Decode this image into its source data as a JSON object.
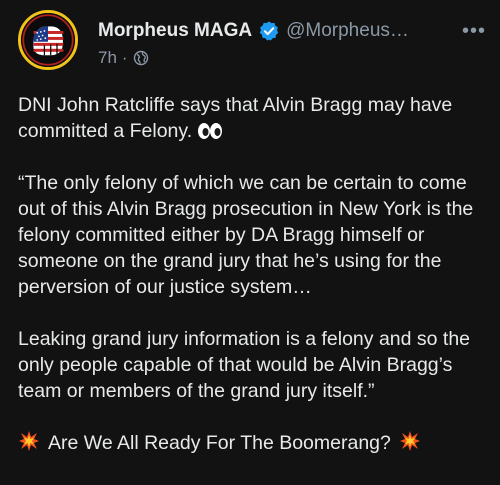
{
  "author": {
    "display_name": "Morpheus MAGA",
    "handle": "@Morpheus…",
    "verified": true,
    "avatar_icon": "american-flag-fist-avatar"
  },
  "meta": {
    "time": "7h",
    "separator": "·",
    "audience_icon": "globe-icon"
  },
  "menu": {
    "more_label": "•••"
  },
  "post": {
    "line1": "DNI John Ratcliffe says that Alvin Bragg may have committed a Felony.",
    "line1_emoji": "eyes-emoji",
    "quote": "“The only felony of which we can be certain to come out of this Alvin Bragg prosecution in New York is the felony committed either by DA Bragg himself or someone on the grand jury that he’s using for the perversion of our justice system…",
    "quote2": "Leaking grand jury information is a felony and so the only people capable of that would be Alvin Bragg’s team or members of the grand jury itself.”",
    "closing": "Are We All Ready For The Boomerang?",
    "closing_emoji": "collision-emoji"
  },
  "colors": {
    "background": "#121212",
    "text": "#e7e9ea",
    "muted": "#8b98a5",
    "verified_badge": "#1d9bf0",
    "avatar_ring": "#f0c419"
  }
}
